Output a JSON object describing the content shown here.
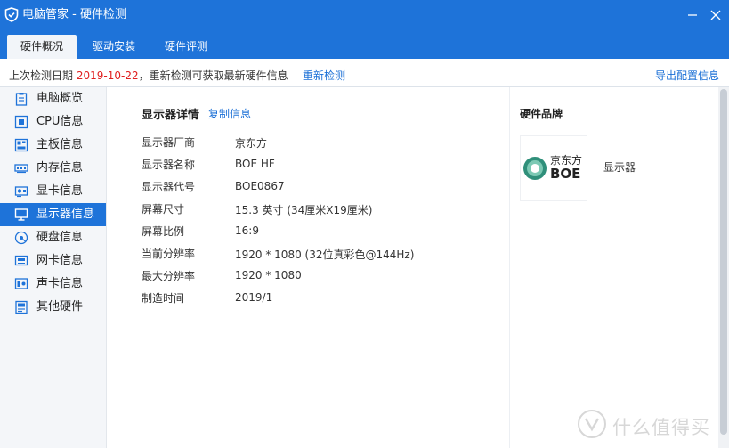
{
  "window": {
    "title": "电脑管家 - 硬件检测",
    "app_icon": "shield-icon",
    "accent_color": "#1e73d9"
  },
  "tabs": [
    {
      "label": "硬件概况",
      "active": true
    },
    {
      "label": "驱动安装",
      "active": false
    },
    {
      "label": "硬件评测",
      "active": false
    }
  ],
  "infobar": {
    "prefix": "上次检测日期",
    "date": "2019-10-22",
    "suffix": "，重新检测可获取最新硬件信息",
    "recheck_label": "重新检测",
    "export_label": "导出配置信息",
    "date_color": "#e02020",
    "link_color": "#1a6fd6"
  },
  "sidebar": {
    "items": [
      {
        "label": "电脑概览",
        "icon": "clipboard-icon",
        "active": false
      },
      {
        "label": "CPU信息",
        "icon": "cpu-icon",
        "active": false
      },
      {
        "label": "主板信息",
        "icon": "motherboard-icon",
        "active": false
      },
      {
        "label": "内存信息",
        "icon": "memory-icon",
        "active": false
      },
      {
        "label": "显卡信息",
        "icon": "graphics-card-icon",
        "active": false
      },
      {
        "label": "显示器信息",
        "icon": "monitor-icon",
        "active": true
      },
      {
        "label": "硬盘信息",
        "icon": "disk-icon",
        "active": false
      },
      {
        "label": "网卡信息",
        "icon": "network-card-icon",
        "active": false
      },
      {
        "label": "声卡信息",
        "icon": "sound-card-icon",
        "active": false
      },
      {
        "label": "其他硬件",
        "icon": "other-hardware-icon",
        "active": false
      }
    ]
  },
  "detail": {
    "title": "显示器详情",
    "copy_label": "复制信息",
    "rows": [
      {
        "label": "显示器厂商",
        "value": "京东方"
      },
      {
        "label": "显示器名称",
        "value": "BOE HF"
      },
      {
        "label": "显示器代号",
        "value": "BOE0867"
      },
      {
        "label": "屏幕尺寸",
        "value": "15.3 英寸 (34厘米X19厘米)"
      },
      {
        "label": "屏幕比例",
        "value": "16:9"
      },
      {
        "label": "当前分辨率",
        "value": "1920 * 1080 (32位真彩色@144Hz)"
      },
      {
        "label": "最大分辨率",
        "value": "1920 * 1080"
      },
      {
        "label": "制造时间",
        "value": "2019/1"
      }
    ]
  },
  "brand": {
    "title": "硬件品牌",
    "logo_cn": "京东方",
    "logo_en": "BOE",
    "category": "显示器"
  },
  "watermark": {
    "text": "什么值得买"
  }
}
